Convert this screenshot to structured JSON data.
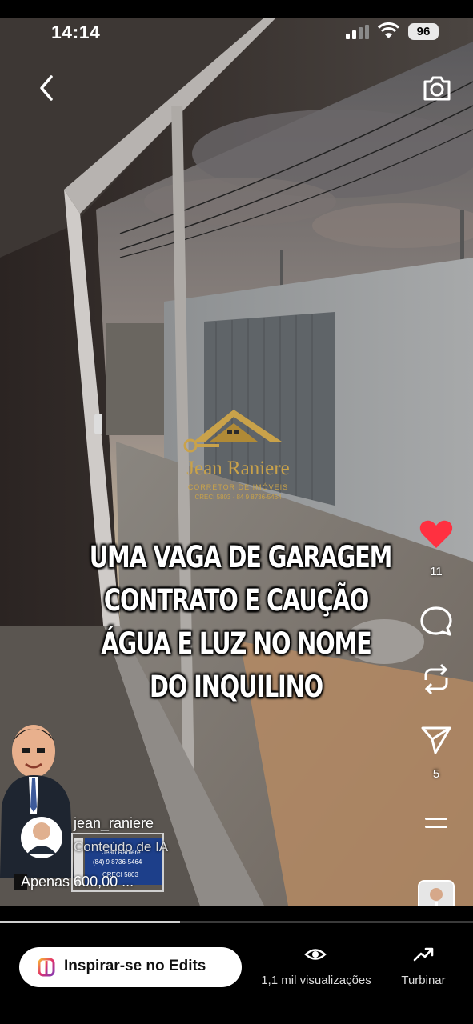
{
  "status_bar": {
    "time": "14:14",
    "battery": "96"
  },
  "colors": {
    "accent_like": "#ff3040",
    "logo_gold": "#c9a24a"
  },
  "logo": {
    "name": "Jean Raniere",
    "subtitle": "CORRETOR DE IMÓVEIS",
    "phones": "CRECI 5803 · 84 9 8736-5464"
  },
  "caption_lines": [
    "UMA VAGA DE GARAGEM",
    "CONTRATO E CAUÇÃO",
    "ÁGUA E LUZ NO NOME",
    "DO INQUILINO"
  ],
  "rail": {
    "like_icon": "heart-filled-icon",
    "like_count": "11",
    "comment_icon": "comment-icon",
    "repost_icon": "repost-icon",
    "share_icon": "send-icon",
    "share_count": "5",
    "more_icon": "menu-icon"
  },
  "author": {
    "username": "jean_raniere",
    "ai_label": "Conteúdo de IA",
    "price_text": "Apenas 600,00 ..."
  },
  "signboard": {
    "line1": "Jean Raniere",
    "line2": "(84) 9 8736-5464",
    "line3": "CRECI 5803"
  },
  "playback": {
    "progress": 0.38
  },
  "bottom_bar": {
    "edits_label": "Inspirar-se no Edits",
    "views_label": "1,1 mil visualizações",
    "boost_label": "Turbinar"
  }
}
